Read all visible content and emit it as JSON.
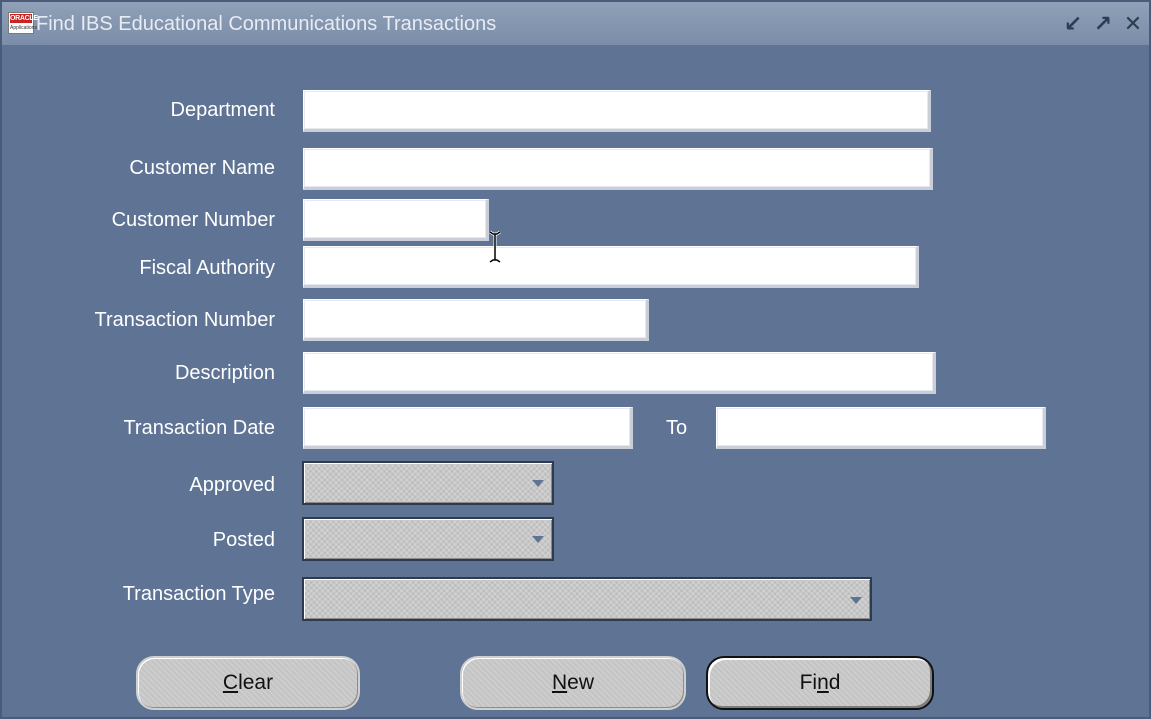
{
  "window": {
    "title": "Find IBS Educational Communications Transactions",
    "logo_text": "ORACLE",
    "logo_subtext": "Applications",
    "controls": [
      "minimize-icon",
      "maximize-icon",
      "close-icon"
    ]
  },
  "form": {
    "department_label": "Department",
    "department_value": "",
    "customer_name_label": "Customer Name",
    "customer_name_value": "",
    "customer_number_label": "Customer Number",
    "customer_number_value": "",
    "fiscal_authority_label": "Fiscal Authority",
    "fiscal_authority_value": "",
    "transaction_number_label": "Transaction Number",
    "transaction_number_value": "",
    "description_label": "Description",
    "description_value": "",
    "transaction_date_label": "Transaction Date",
    "transaction_date_from": "",
    "to_label": "To",
    "transaction_date_to": "",
    "approved_label": "Approved",
    "approved_value": "",
    "posted_label": "Posted",
    "posted_value": "",
    "transaction_type_label": "Transaction Type",
    "transaction_type_value": ""
  },
  "buttons": {
    "clear_rest": "lear",
    "clear_first": "C",
    "new_first": "N",
    "new_rest": "ew",
    "find_first": "Fi",
    "find_mid": "n",
    "find_rest": "d"
  },
  "colors": {
    "window_bg": "#5f7394",
    "titlebar": "#7b8da8",
    "field_bg": "#ffffff",
    "button_face": "#c4c4c4"
  }
}
